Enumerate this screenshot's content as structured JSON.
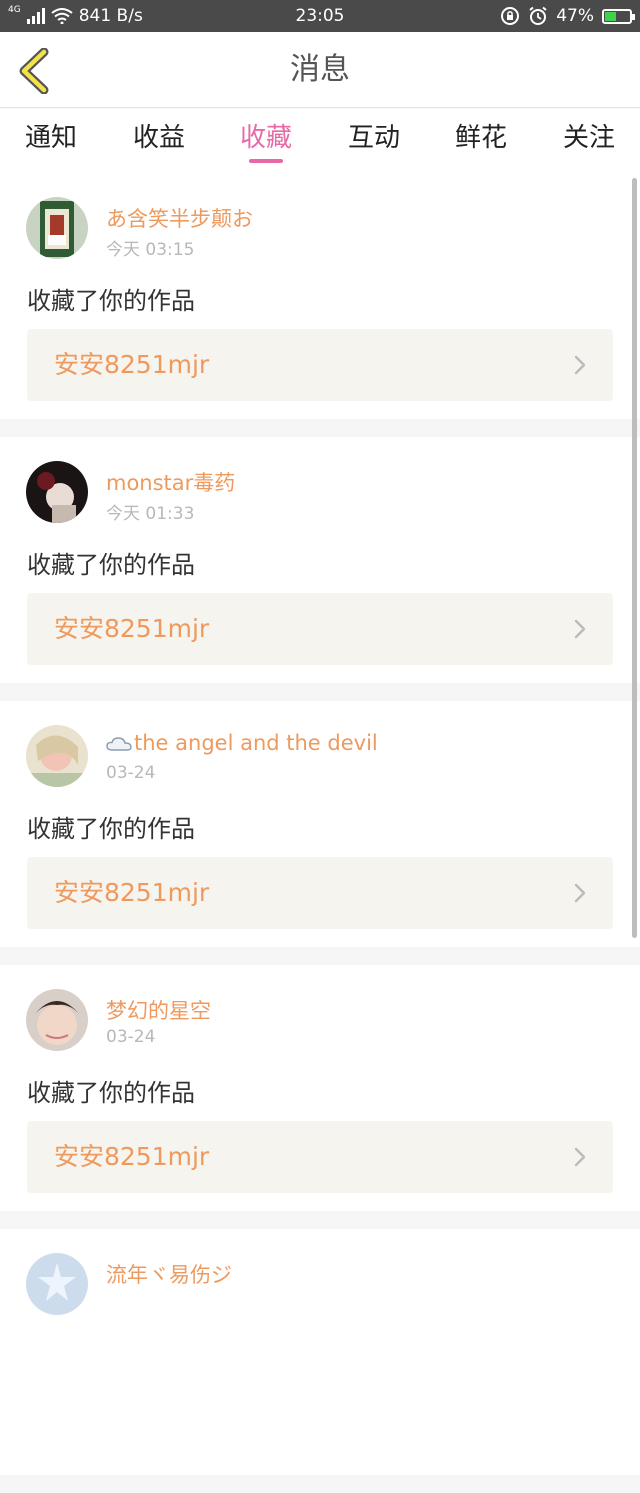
{
  "status_bar": {
    "network_type": "4G",
    "speed": "841 B/s",
    "time": "23:05",
    "battery": "47%",
    "battery_level": 0.47
  },
  "header": {
    "title": "消息"
  },
  "tabs": [
    {
      "label": "通知"
    },
    {
      "label": "收益"
    },
    {
      "label": "收藏",
      "active": true
    },
    {
      "label": "互动"
    },
    {
      "label": "鲜花"
    },
    {
      "label": "关注"
    }
  ],
  "items": [
    {
      "username": "あ含笑半步颠お",
      "time": "今天 03:15",
      "action": "收藏了你的作品",
      "work": "安安8251mjr",
      "avatar_icon": "avatar-photo-icon"
    },
    {
      "username": "monstar毒药",
      "time": "今天 01:33",
      "action": "收藏了你的作品",
      "work": "安安8251mjr",
      "avatar_icon": "avatar-photo-icon"
    },
    {
      "username": "the angel and the devil",
      "time": "03-24",
      "action": "收藏了你的作品",
      "work": "安安8251mjr",
      "avatar_icon": "avatar-photo-icon",
      "name_icon": "cloud-icon"
    },
    {
      "username": "梦幻的星空",
      "time": "03-24",
      "action": "收藏了你的作品",
      "work": "安安8251mjr",
      "avatar_icon": "avatar-photo-icon"
    },
    {
      "username": "流年ヾ易伤ジ",
      "time": "",
      "action": "",
      "work": "",
      "avatar_icon": "avatar-default-icon"
    }
  ],
  "colors": {
    "accent": "#e56aa6",
    "username": "#ee9a5e",
    "status_bar": "#4a4a4a"
  }
}
